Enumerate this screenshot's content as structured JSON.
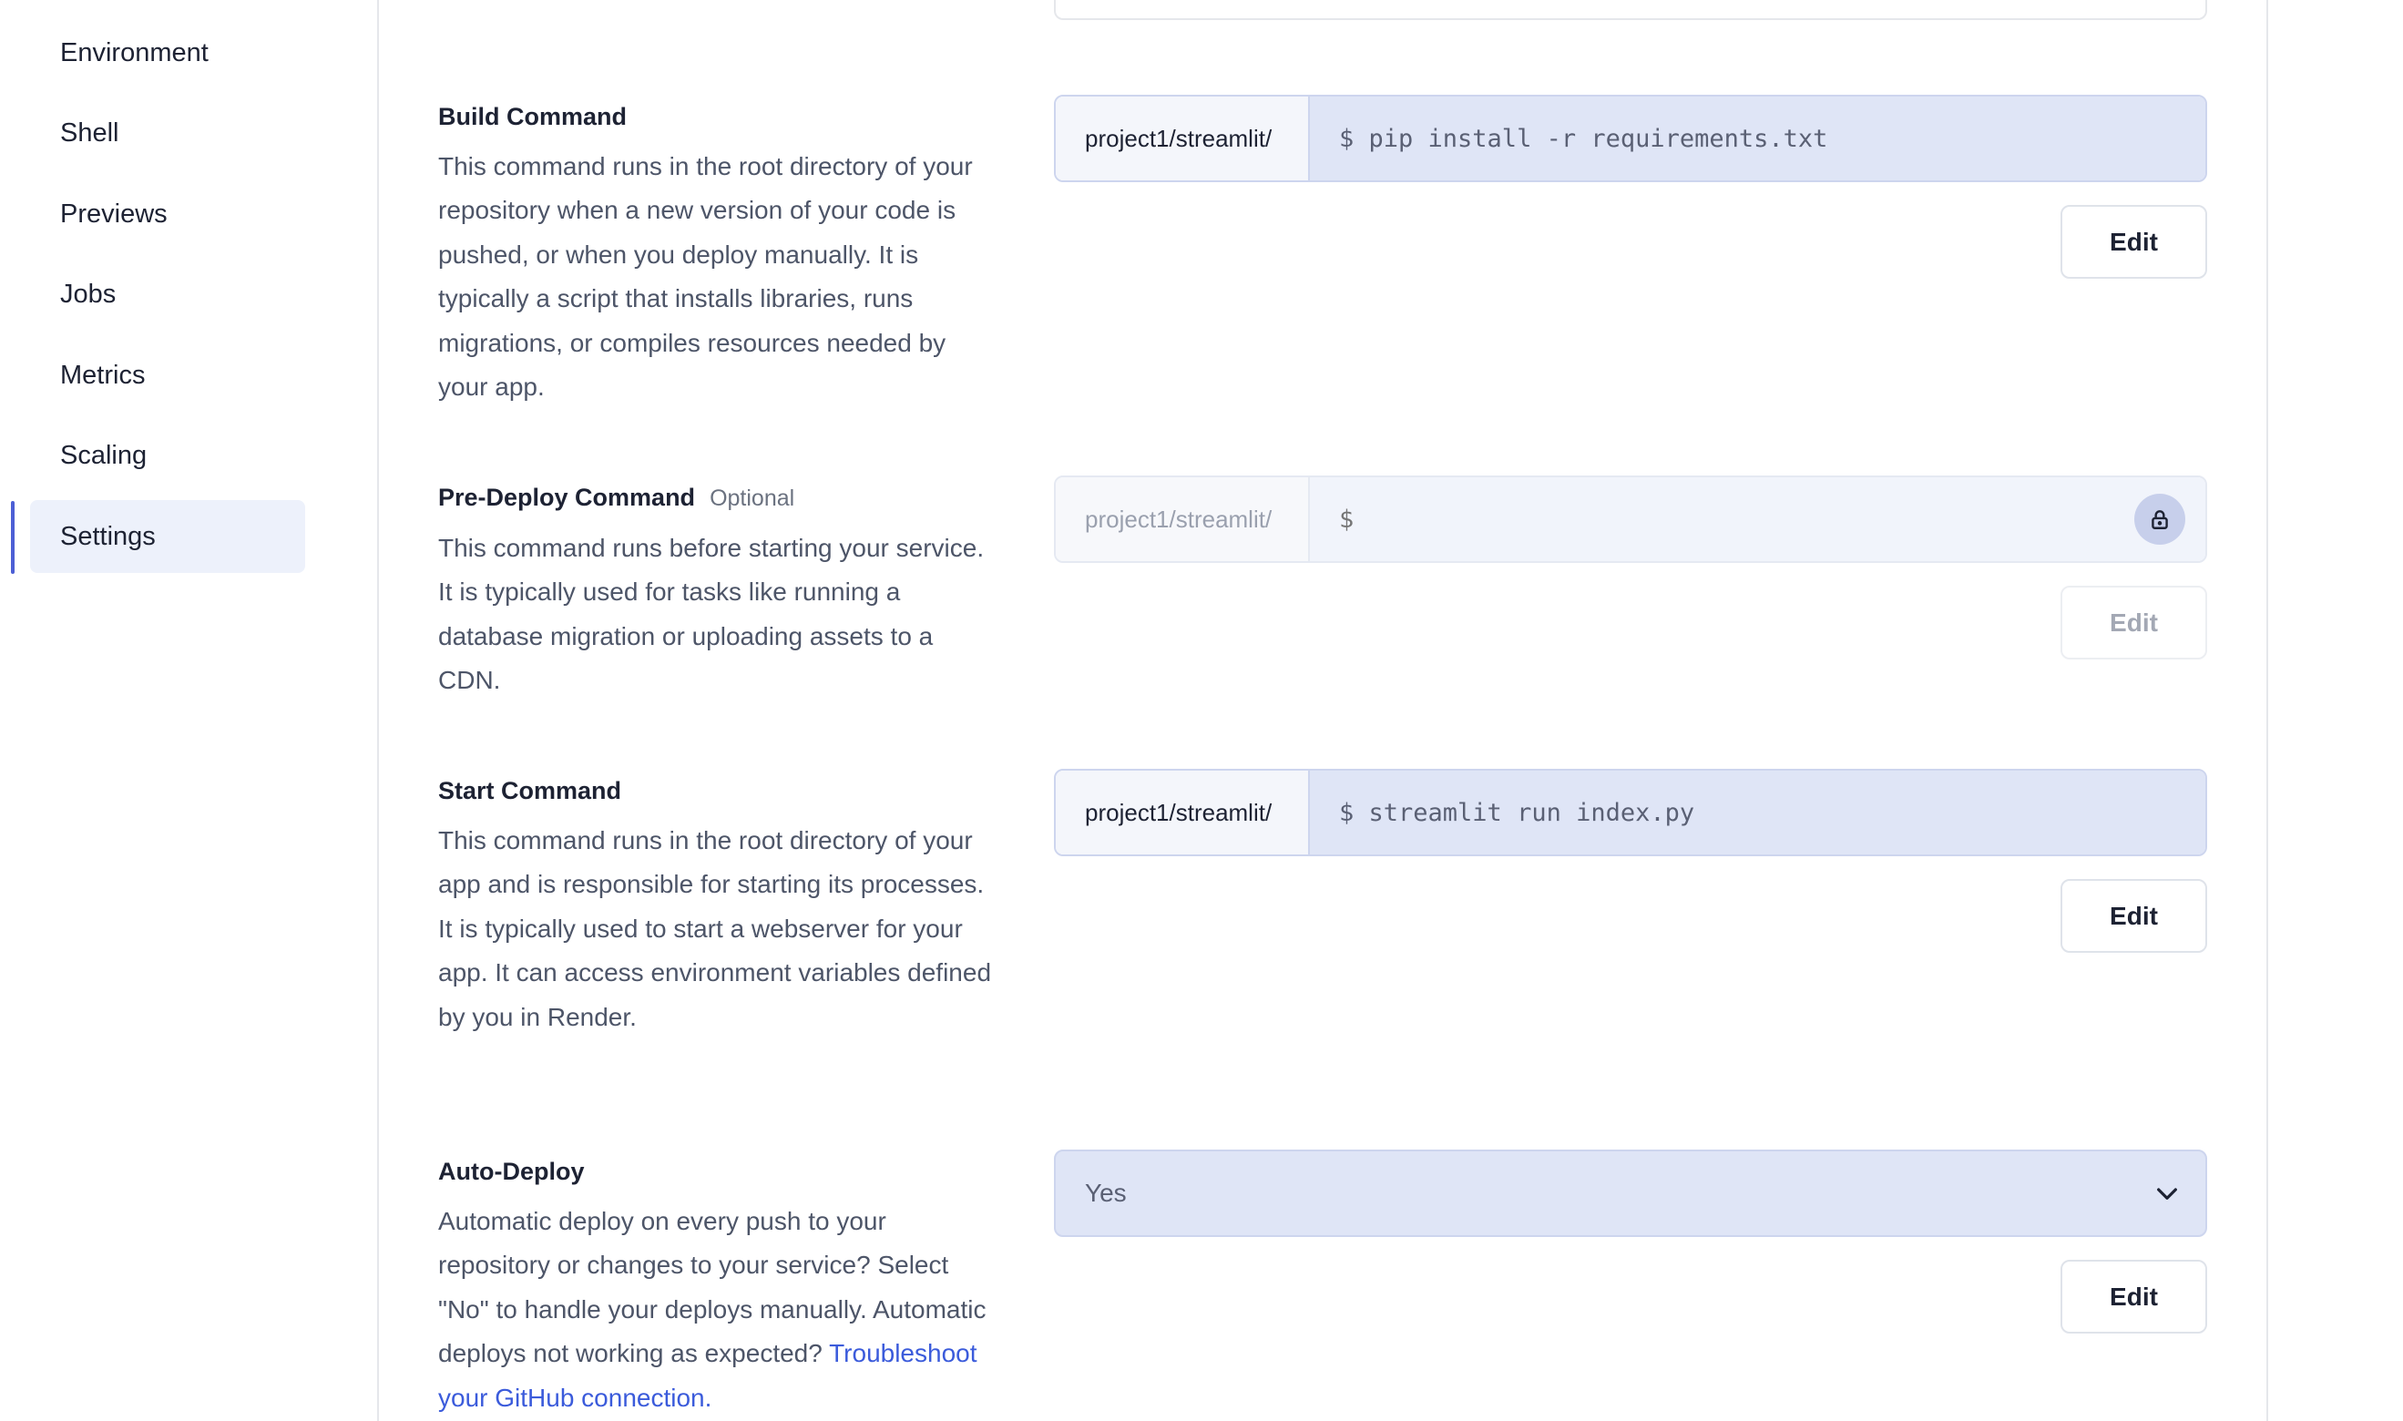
{
  "sidebar": {
    "items": [
      {
        "label": "Environment"
      },
      {
        "label": "Shell"
      },
      {
        "label": "Previews"
      },
      {
        "label": "Jobs"
      },
      {
        "label": "Metrics"
      },
      {
        "label": "Scaling"
      },
      {
        "label": "Settings",
        "active": true
      }
    ]
  },
  "build_command": {
    "title": "Build Command",
    "description": "This command runs in the root directory of your repository when a new version of your code is pushed, or when you deploy manually. It is typically a script that installs libraries, runs migrations, or compiles resources needed by your app.",
    "prefix": "project1/streamlit/",
    "value": "$ pip install -r requirements.txt",
    "edit_label": "Edit"
  },
  "pre_deploy_command": {
    "title": "Pre-Deploy Command",
    "optional_label": "Optional",
    "description": "This command runs before starting your service. It is typically used for tasks like running a database migration or uploading assets to a CDN.",
    "prefix": "project1/streamlit/",
    "placeholder": "$",
    "edit_label": "Edit",
    "locked_icon": "lock-icon"
  },
  "start_command": {
    "title": "Start Command",
    "description": "This command runs in the root directory of your app and is responsible for starting its processes. It is typically used to start a webserver for your app. It can access environment variables defined by you in Render.",
    "prefix": "project1/streamlit/",
    "value": "$ streamlit run index.py",
    "edit_label": "Edit"
  },
  "auto_deploy": {
    "title": "Auto-Deploy",
    "description": "Automatic deploy on every push to your repository or changes to your service? Select \"No\" to handle your deploys manually. Automatic deploys not working as expected?",
    "link_text": "Troubleshoot your GitHub connection.",
    "selected": "Yes",
    "edit_label": "Edit"
  },
  "colors": {
    "accent": "#4c5fd5",
    "link": "#3b5bdb",
    "input_bg": "#dfe5f6",
    "active_nav_bg": "#edf1fb"
  }
}
